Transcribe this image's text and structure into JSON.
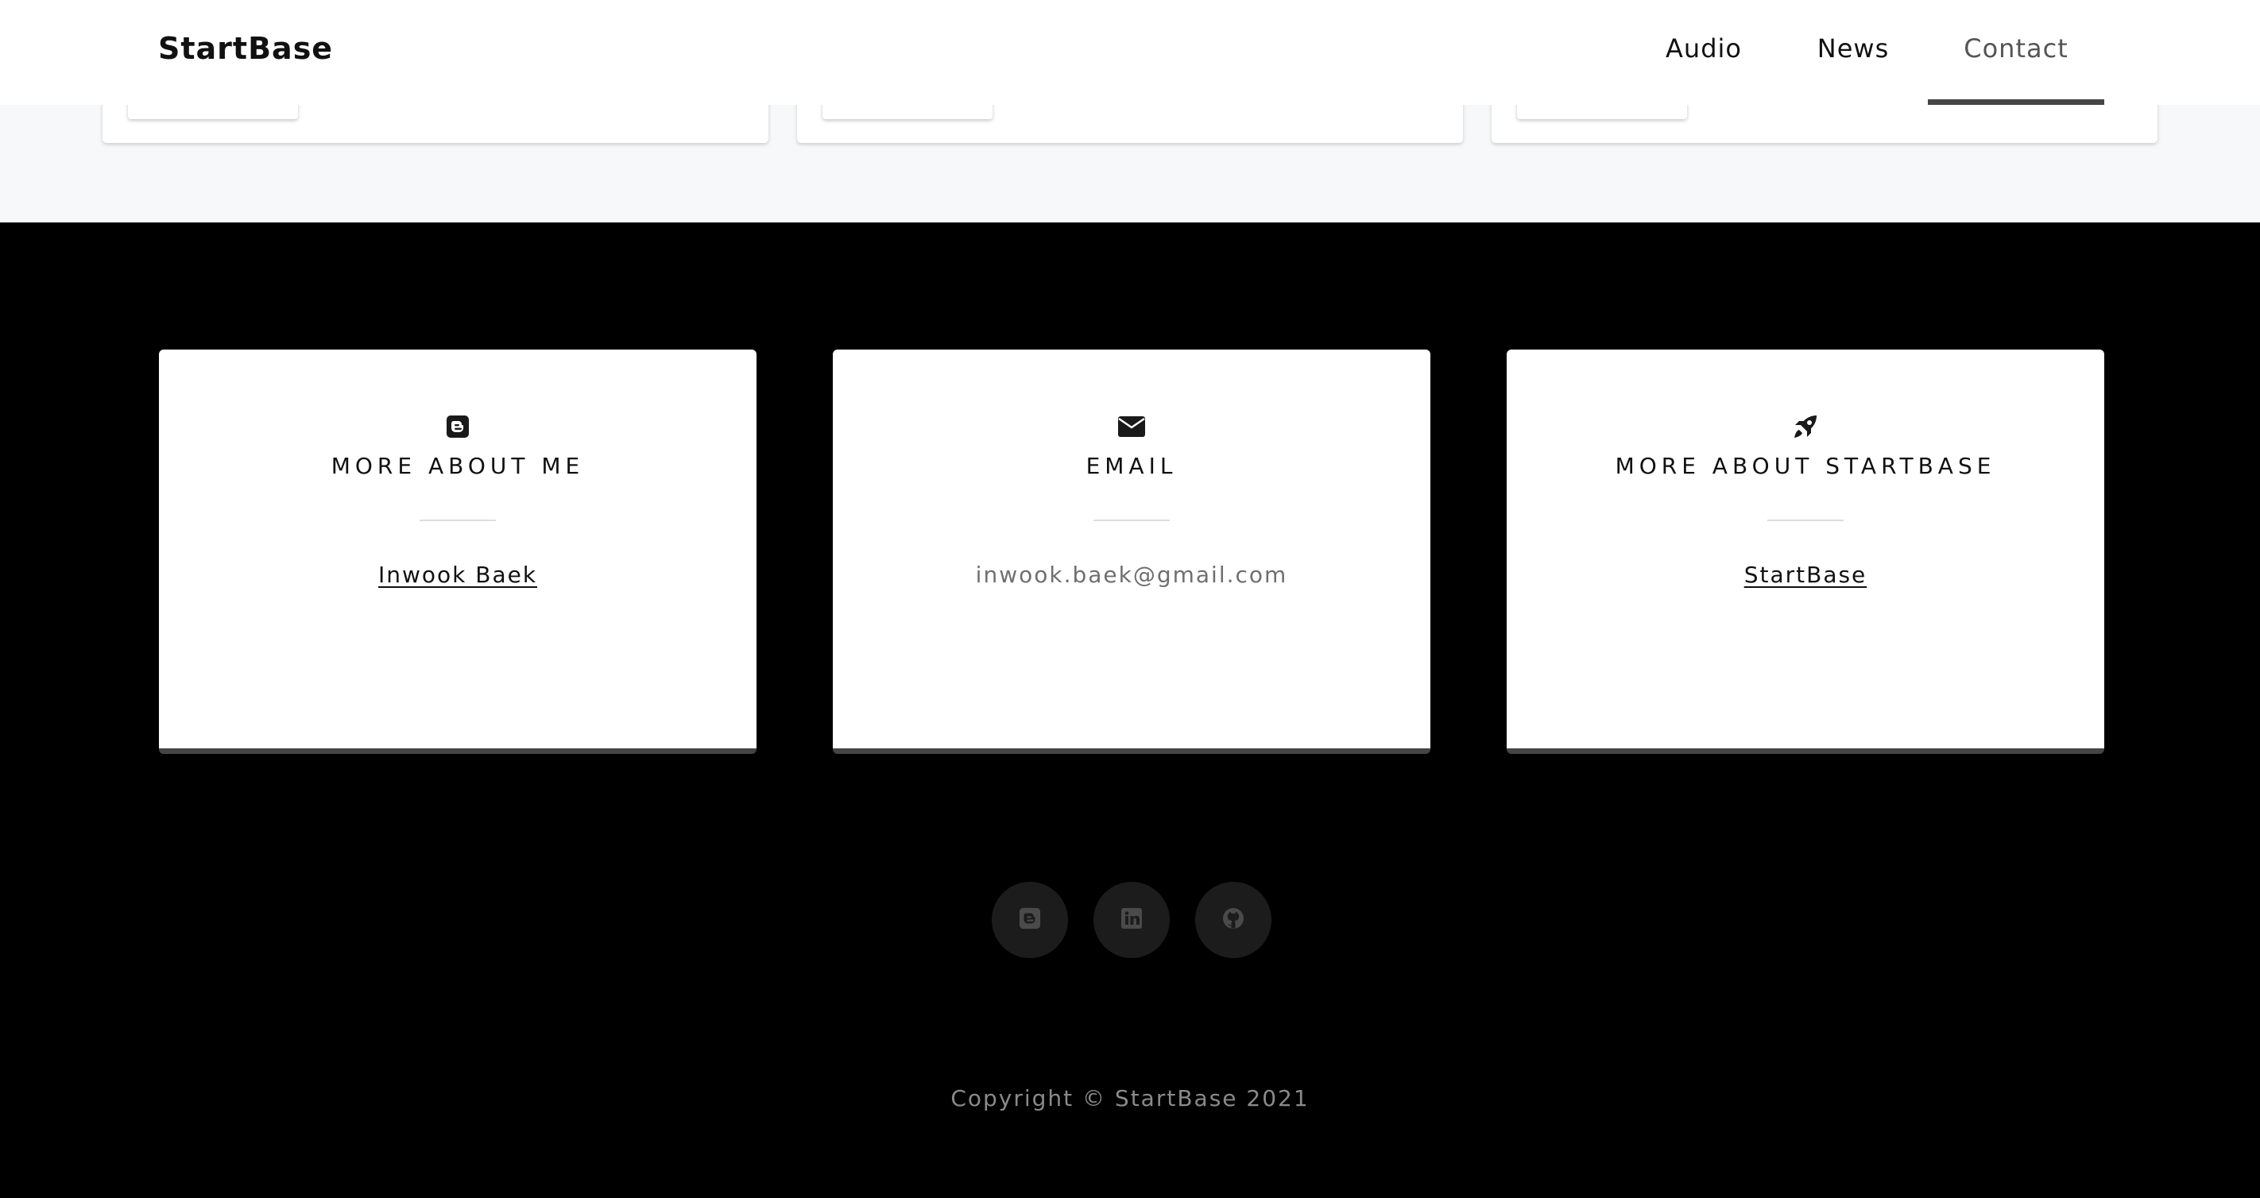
{
  "nav": {
    "brand": "StartBase",
    "items": [
      {
        "label": "Audio",
        "active": false
      },
      {
        "label": "News",
        "active": false
      },
      {
        "label": "Contact",
        "active": true
      }
    ]
  },
  "contact": {
    "cards": [
      {
        "icon": "blogger-icon",
        "title": "MORE ABOUT ME",
        "value": "Inwook Baek",
        "is_link": true
      },
      {
        "icon": "envelope-icon",
        "title": "EMAIL",
        "value": "inwook.baek@gmail.com",
        "is_link": false
      },
      {
        "icon": "rocket-icon",
        "title": "MORE ABOUT STARTBASE",
        "value": "StartBase",
        "is_link": true
      }
    ]
  },
  "social": [
    {
      "icon": "blogger-icon"
    },
    {
      "icon": "linkedin-icon"
    },
    {
      "icon": "github-icon"
    }
  ],
  "footer": {
    "copyright": "Copyright © StartBase 2021"
  },
  "colors": {
    "accent_bar": "#454545",
    "footer_bg": "#000000",
    "section_bg": "#f7f8f9"
  }
}
